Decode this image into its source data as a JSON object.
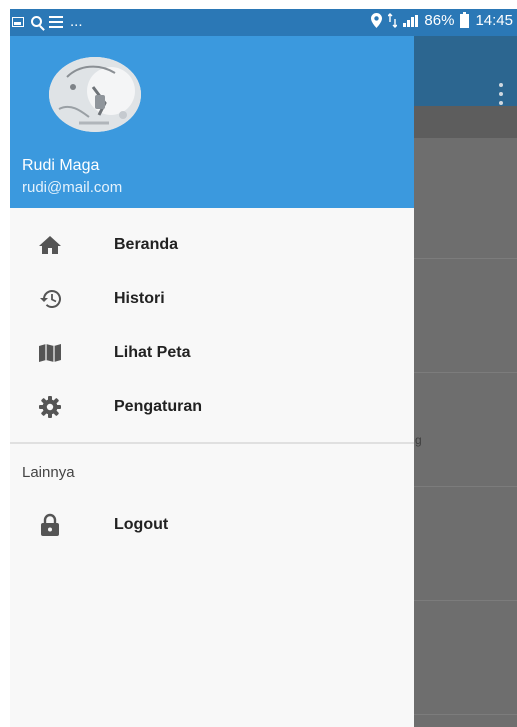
{
  "status_bar": {
    "left_icons": [
      "image-icon",
      "search-icon",
      "list-icon"
    ],
    "left_overflow": "...",
    "right_icons": [
      "location-icon",
      "network-icon",
      "signal-icon"
    ],
    "battery_percent": "86%",
    "battery_icon": "battery-charging-icon",
    "time": "14:45"
  },
  "drawer": {
    "user": {
      "name": "Rudi Maga",
      "email": "rudi@mail.com"
    },
    "menu": [
      {
        "label": "Beranda",
        "icon": "home-icon"
      },
      {
        "label": "Histori",
        "icon": "history-icon"
      },
      {
        "label": "Lihat Peta",
        "icon": "map-icon"
      },
      {
        "label": "Pengaturan",
        "icon": "gear-icon"
      }
    ],
    "section_label": "Lainnya",
    "secondary_menu": [
      {
        "label": "Logout",
        "icon": "lock-icon"
      }
    ]
  },
  "background": {
    "snippet": "g",
    "overflow_icon": "more-vert-icon"
  },
  "colors": {
    "status_bar": "#2b78b6",
    "drawer_header": "#3b99de",
    "app_bar_dimmed": "#2c6690",
    "scrim": "#6b6b6b"
  }
}
